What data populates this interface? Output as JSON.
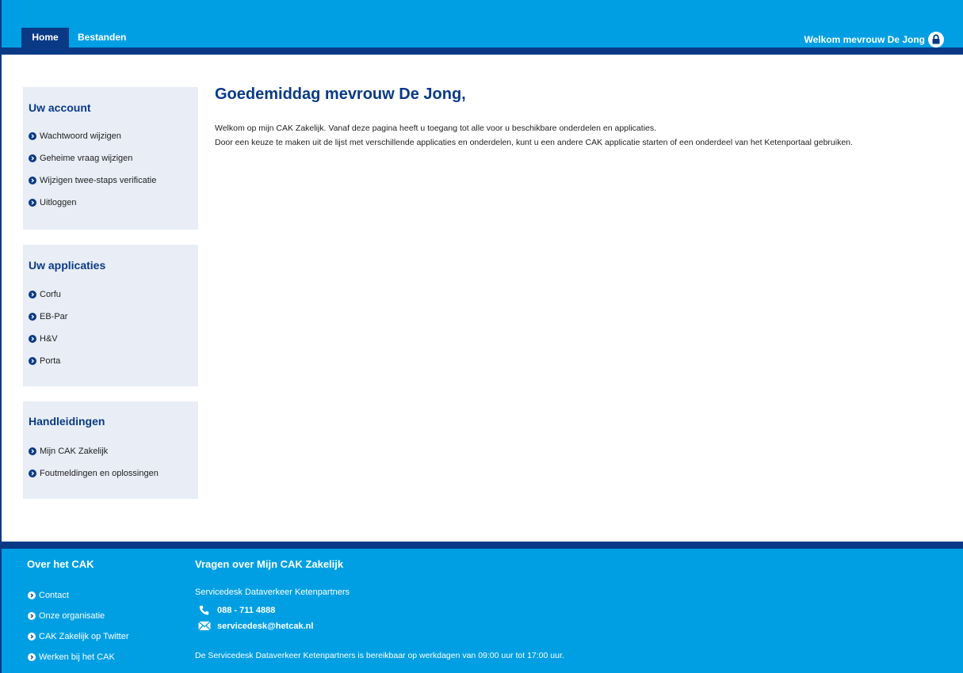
{
  "nav": {
    "tabs": [
      {
        "label": "Home",
        "active": true
      },
      {
        "label": "Bestanden",
        "active": false
      }
    ],
    "welcome": "Welkom mevrouw De Jong"
  },
  "sidebar": {
    "account": {
      "title": "Uw account",
      "items": [
        "Wachtwoord wijzigen",
        "Geheime vraag wijzigen",
        "Wijzigen twee-staps verificatie",
        "Uitloggen"
      ]
    },
    "apps": {
      "title": "Uw applicaties",
      "items": [
        "Corfu",
        "EB-Par",
        "H&V",
        "Porta"
      ]
    },
    "manuals": {
      "title": "Handleidingen",
      "items": [
        "Mijn CAK Zakelijk",
        "Foutmeldingen en oplossingen"
      ]
    }
  },
  "main": {
    "greeting": "Goedemiddag mevrouw De Jong,",
    "intro_line1": "Welkom op mijn CAK Zakelijk. Vanaf deze pagina heeft u toegang tot alle voor u beschikbare onderdelen en applicaties.",
    "intro_line2": "Door een keuze te maken uit de lijst met verschillende applicaties en onderdelen, kunt u een andere CAK applicatie starten of een onderdeel van het Ketenportaal gebruiken."
  },
  "footer": {
    "about_title": "Over het CAK",
    "about_links": [
      "Contact",
      "Onze organisatie",
      "CAK Zakelijk op Twitter",
      "Werken bij het CAK"
    ],
    "questions_title": "Vragen over Mijn CAK Zakelijk",
    "servicedesk_name": "Servicedesk Dataverkeer Ketenpartners",
    "phone": "088 - 711 4888",
    "email": "servicedesk@hetcak.nl",
    "hours": "De Servicedesk Dataverkeer Ketenpartners is bereikbaar op werkdagen van 09:00 uur tot 17:00 uur."
  },
  "colors": {
    "brand_light_blue": "#009fe3",
    "brand_dark_blue": "#0a3a85",
    "sidebar_bg": "#e8edf6"
  },
  "icons": {
    "lock": "lock-icon",
    "bullet": "chevron-right-circle-icon",
    "phone": "phone-icon",
    "mail": "mail-icon"
  }
}
